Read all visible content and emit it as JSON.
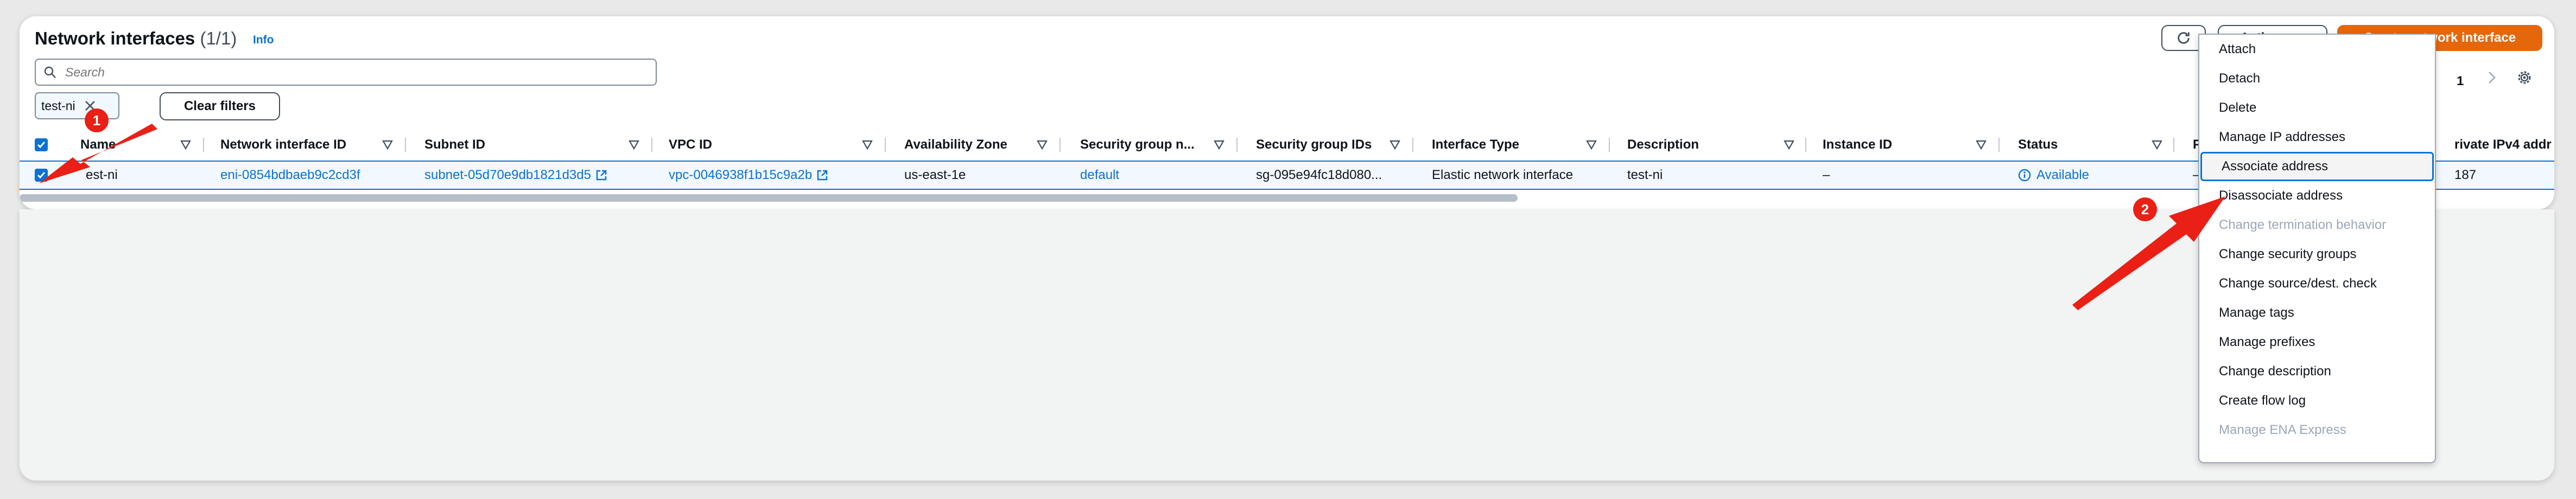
{
  "header": {
    "title": "Network interfaces",
    "count": "(1/1)",
    "info": "Info"
  },
  "buttons": {
    "actions": "Actions",
    "create": "Create network interface",
    "clear_filters": "Clear filters"
  },
  "search": {
    "placeholder": "Search",
    "value": ""
  },
  "filter_token": {
    "label": "test-ni"
  },
  "pagination": {
    "page": "1"
  },
  "columns": [
    "Name",
    "Network interface ID",
    "Subnet ID",
    "VPC ID",
    "Availability Zone",
    "Security group n...",
    "Security group IDs",
    "Interface Type",
    "Description",
    "Instance ID",
    "Status",
    "Pub",
    "rivate IPv4 addr"
  ],
  "row": {
    "name": "est-ni",
    "eni_id": "eni-0854bdbaeb9c2cd3f",
    "subnet_id": "subnet-05d70e9db1821d3d5",
    "vpc_id": "vpc-0046938f1b15c9a2b",
    "az": "us-east-1e",
    "sg_name": "default",
    "sg_ids": "sg-095e94fc18d080...",
    "interface_type": "Elastic network interface",
    "description": "test-ni",
    "instance_id": "–",
    "status": "Available",
    "public": "–",
    "private_ip": "187"
  },
  "menu": [
    {
      "label": "Attach",
      "state": "enabled"
    },
    {
      "label": "Detach",
      "state": "enabled"
    },
    {
      "label": "Delete",
      "state": "enabled"
    },
    {
      "label": "Manage IP addresses",
      "state": "enabled"
    },
    {
      "label": "Associate address",
      "state": "focused"
    },
    {
      "label": "Disassociate address",
      "state": "enabled"
    },
    {
      "label": "Change termination behavior",
      "state": "disabled"
    },
    {
      "label": "Change security groups",
      "state": "enabled"
    },
    {
      "label": "Change source/dest. check",
      "state": "enabled"
    },
    {
      "label": "Manage tags",
      "state": "enabled"
    },
    {
      "label": "Manage prefixes",
      "state": "enabled"
    },
    {
      "label": "Change description",
      "state": "enabled"
    },
    {
      "label": "Create flow log",
      "state": "enabled"
    },
    {
      "label": "Manage ENA Express",
      "state": "disabled"
    }
  ],
  "annotations": {
    "step1": "1",
    "step2": "2"
  },
  "colors": {
    "primary": "#e5670b",
    "link": "#0972d3",
    "annotation": "#ea1f15",
    "success": "#037f0c"
  },
  "icons": [
    "refresh-icon",
    "caret-up-icon",
    "search-icon",
    "close-icon",
    "chevron-right-icon",
    "gear-icon",
    "sort-icon",
    "external-link-icon",
    "check-icon",
    "status-info-icon"
  ]
}
